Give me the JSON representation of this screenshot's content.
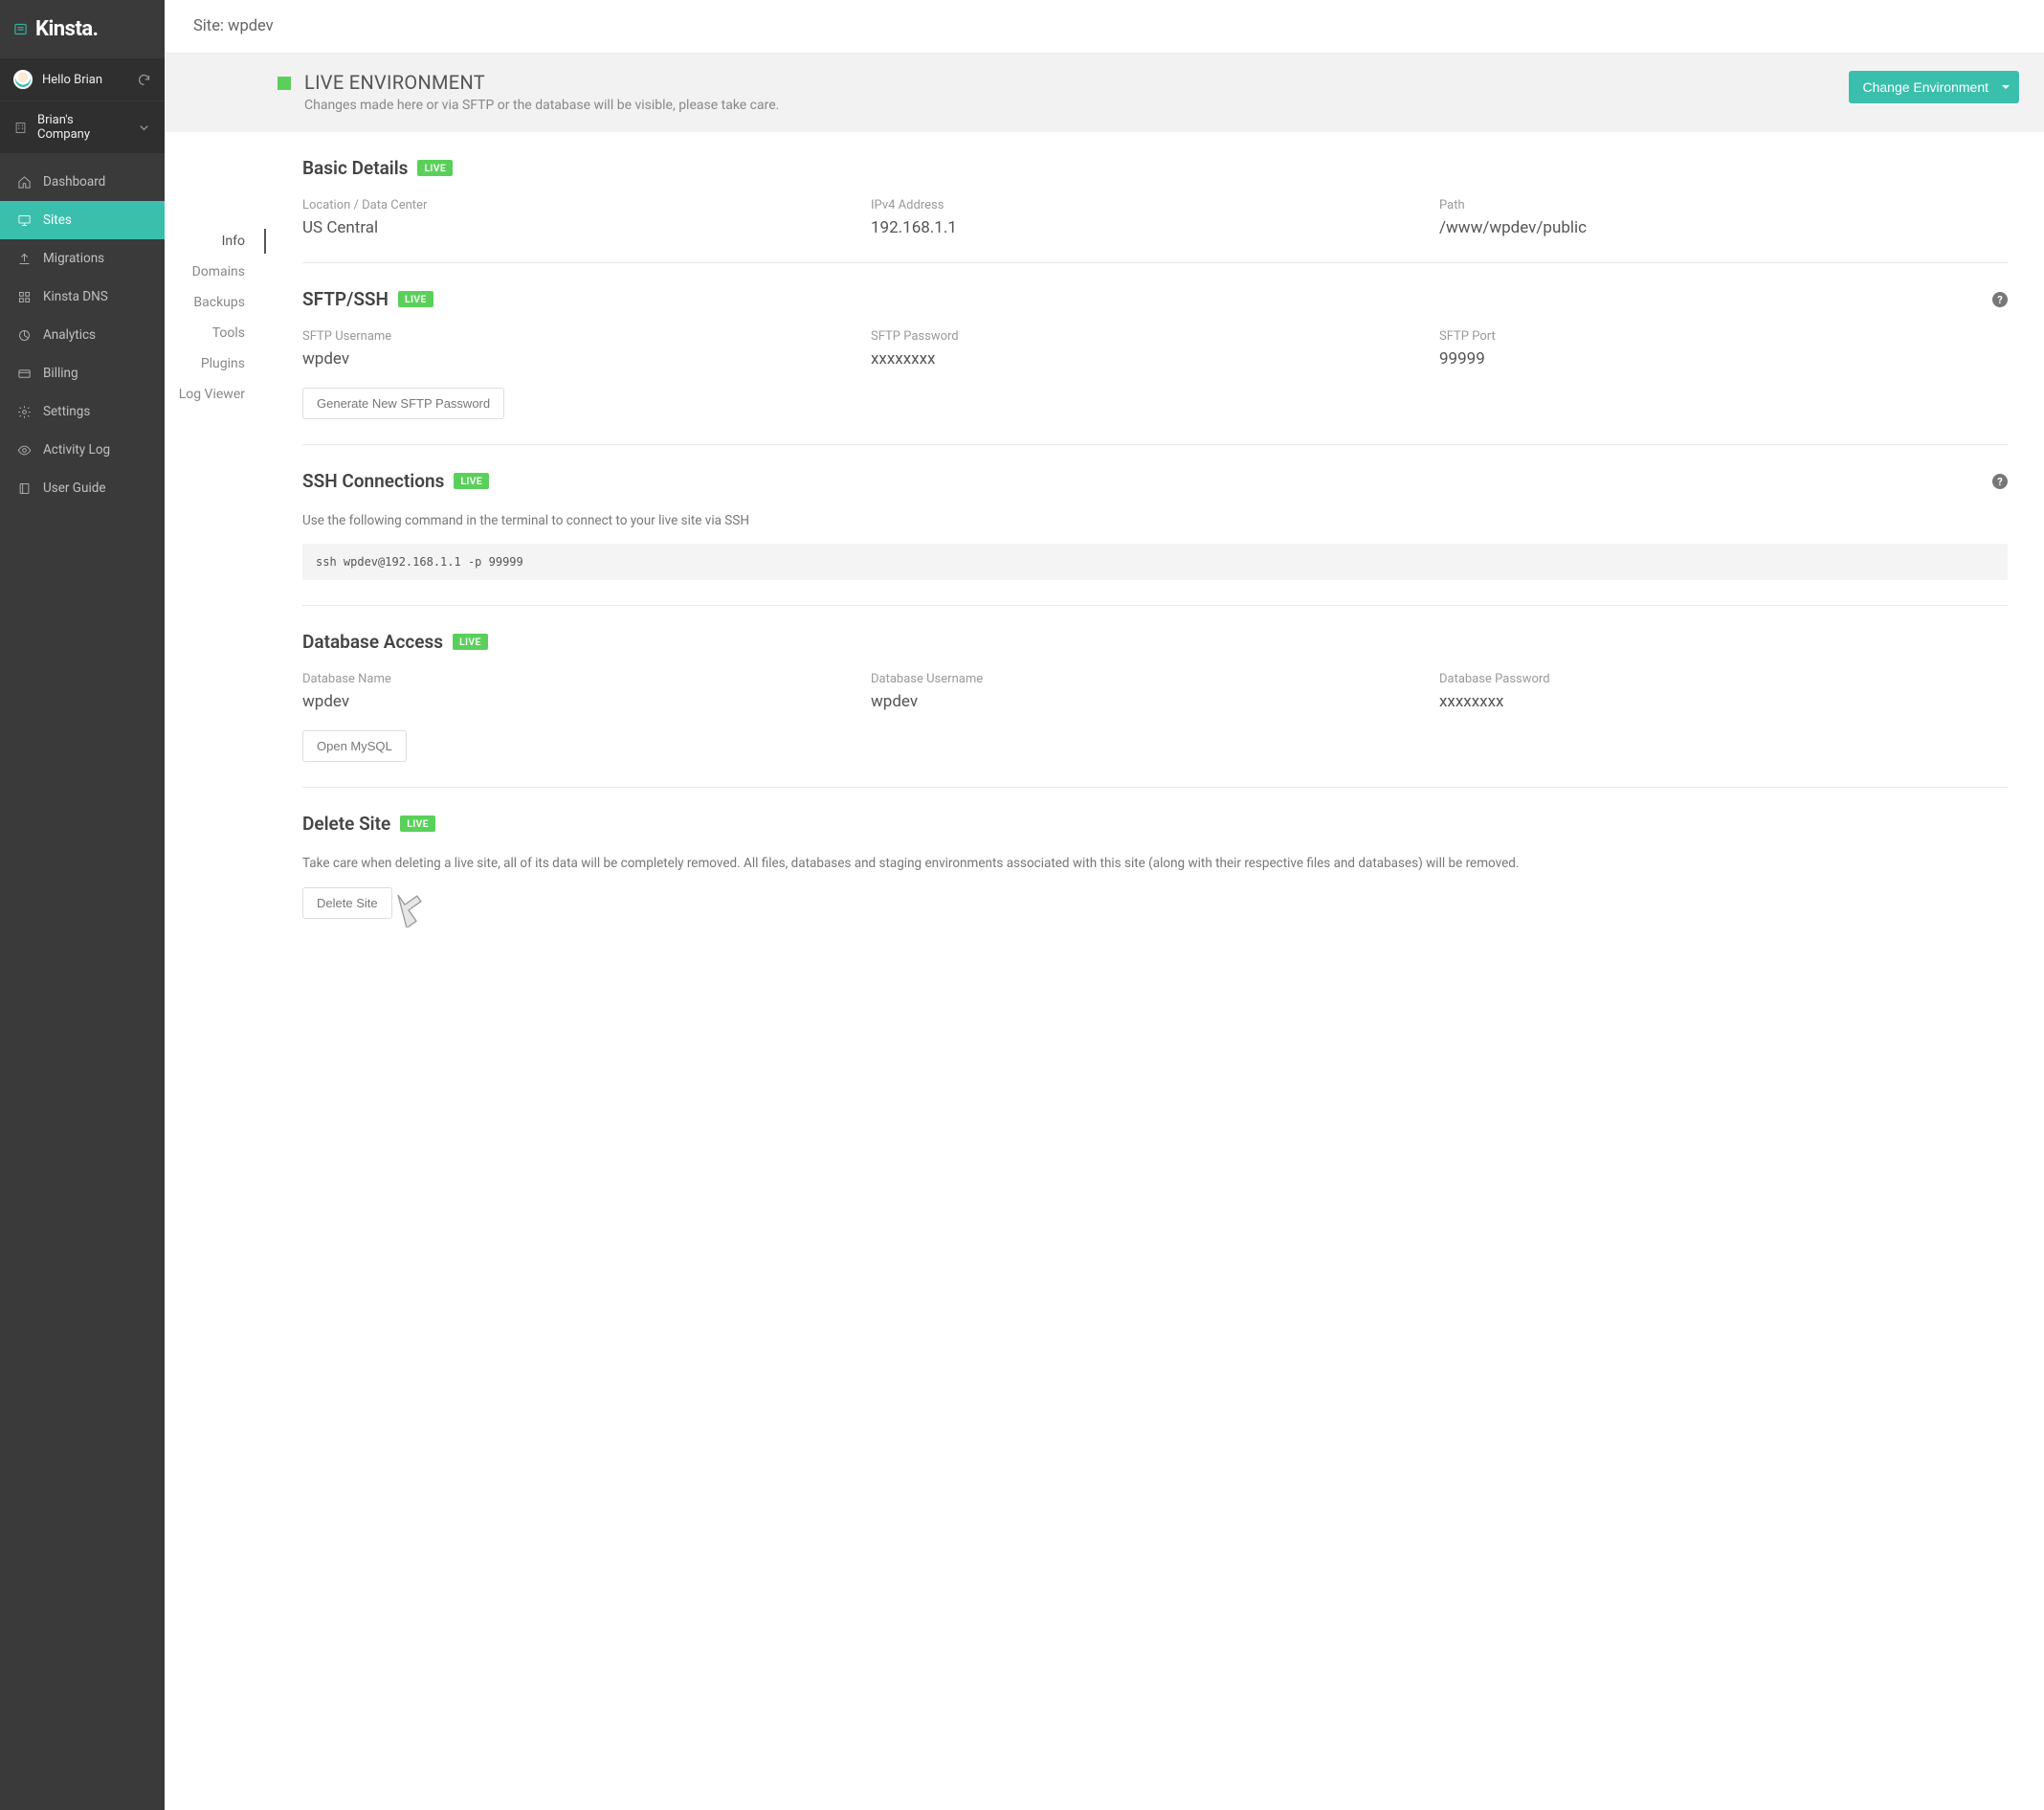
{
  "brand_name": "Kinsta.",
  "user_greeting": "Hello Brian",
  "company_name": "Brian's Company",
  "sidebar": {
    "items": [
      {
        "label": "Dashboard",
        "icon": "home"
      },
      {
        "label": "Sites",
        "icon": "monitor",
        "active": true
      },
      {
        "label": "Migrations",
        "icon": "upload"
      },
      {
        "label": "Kinsta DNS",
        "icon": "grid"
      },
      {
        "label": "Analytics",
        "icon": "pie"
      },
      {
        "label": "Billing",
        "icon": "card"
      },
      {
        "label": "Settings",
        "icon": "gear"
      },
      {
        "label": "Activity Log",
        "icon": "eye"
      },
      {
        "label": "User Guide",
        "icon": "book"
      }
    ]
  },
  "subnav": {
    "items": [
      {
        "label": "Info",
        "active": true
      },
      {
        "label": "Domains"
      },
      {
        "label": "Backups"
      },
      {
        "label": "Tools"
      },
      {
        "label": "Plugins"
      },
      {
        "label": "Log Viewer"
      }
    ]
  },
  "topbar_title": "Site: wpdev",
  "env_strip": {
    "title": "LIVE ENVIRONMENT",
    "subtitle": "Changes made here or via SFTP or the database will be visible, please take care.",
    "change_label": "Change Environment"
  },
  "live_badge": "LIVE",
  "sections": {
    "basic": {
      "title": "Basic Details",
      "location_label": "Location / Data Center",
      "location_value": "US Central",
      "ipv4_label": "IPv4 Address",
      "ipv4_value": "192.168.1.1",
      "path_label": "Path",
      "path_value": "/www/wpdev/public"
    },
    "sftp": {
      "title": "SFTP/SSH",
      "user_label": "SFTP Username",
      "user_value": "wpdev",
      "pass_label": "SFTP Password",
      "pass_value": "xxxxxxxx",
      "port_label": "SFTP Port",
      "port_value": "99999",
      "gen_button": "Generate New SFTP Password"
    },
    "ssh": {
      "title": "SSH Connections",
      "desc": "Use the following command in the terminal to connect to your live site via SSH",
      "command": "ssh wpdev@192.168.1.1 -p 99999"
    },
    "db": {
      "title": "Database Access",
      "name_label": "Database Name",
      "name_value": "wpdev",
      "user_label": "Database Username",
      "user_value": "wpdev",
      "pass_label": "Database Password",
      "pass_value": "xxxxxxxx",
      "open_button": "Open MySQL"
    },
    "delete": {
      "title": "Delete Site",
      "desc": "Take care when deleting a live site, all of its data will be completely removed. All files, databases and staging environments associated with this site (along with their respective files and databases) will be removed.",
      "button": "Delete Site"
    }
  }
}
